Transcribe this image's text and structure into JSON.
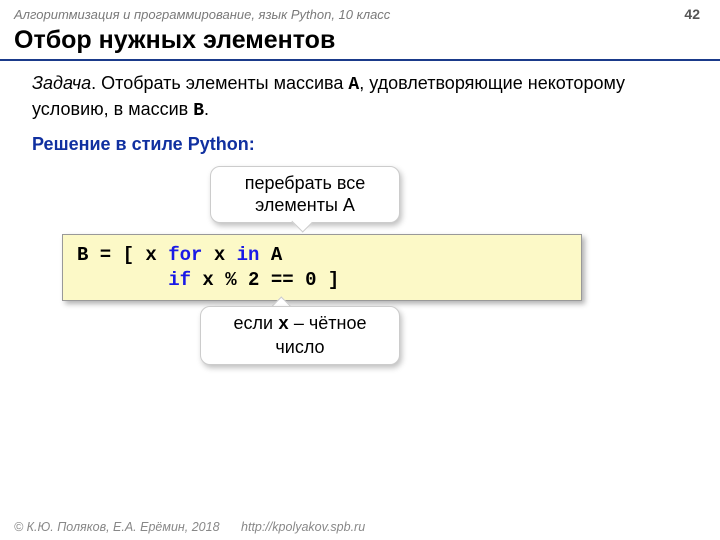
{
  "header": {
    "subject": "Алгоритмизация и программирование, язык Python, 10 класс",
    "page_number": "42"
  },
  "title": "Отбор нужных элементов",
  "task": {
    "label": "Задача",
    "text_1": ". Отобрать элементы массива ",
    "arr_a": "A",
    "text_2": ", удовлетворяющие некоторому условию, в массив ",
    "arr_b": "B",
    "text_3": "."
  },
  "solution_label": "Решение в стиле Python:",
  "callout_top": {
    "line1": "перебрать все",
    "line2": "элементы A"
  },
  "code": {
    "t1": "B = [ x ",
    "kw_for": "for",
    "t2": " x ",
    "kw_in": "in",
    "t3": " A",
    "t4": "        ",
    "kw_if": "if",
    "t5": " x % ",
    "n2": "2",
    "t6": " == ",
    "n0": "0",
    "t7": " ]"
  },
  "callout_bottom": {
    "t1": "если ",
    "x": "x",
    "t2": " – чётное",
    "line2": "число"
  },
  "footer": {
    "copyright": "© К.Ю. Поляков, Е.А. Ерёмин, 2018",
    "link": "http://kpolyakov.spb.ru"
  }
}
